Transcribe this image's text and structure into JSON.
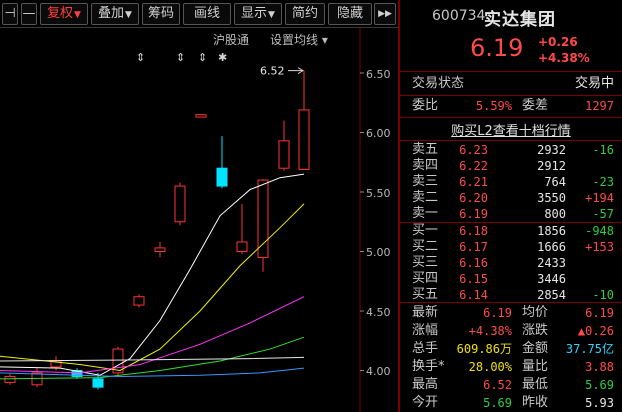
{
  "toolbar": {
    "first_glyph": "⊣",
    "minus": "—",
    "fuquan": "复权",
    "diejia": "叠加",
    "chouma": "筹码",
    "huaxian": "画线",
    "xianshi": "显示",
    "jianyue": "简约",
    "yincang": "隐藏",
    "dropdown_glyph": "▼",
    "expand_glyph": "▶▶"
  },
  "chart": {
    "link_hugutong": "沪股通",
    "link_settings": "设置均线",
    "settings_arrow": "▾",
    "marker_high_label": "6.52",
    "event_marks": [
      "⇕",
      "⇕",
      "⇕",
      "✱"
    ],
    "price_axis": [
      "6.50",
      "6.00",
      "5.50",
      "5.00",
      "4.50",
      "4.00"
    ],
    "colors": {
      "up": "#ff3232",
      "down": "#00e5ff",
      "ma_white": "#ffffff",
      "ma_yellow": "#f0f000",
      "ma_magenta": "#ff33ff",
      "ma_green": "#33dd33",
      "ma_blue": "#3399ff"
    }
  },
  "quote": {
    "code": "600734",
    "name": "实达集团",
    "price": "6.19",
    "change": "+0.26",
    "change_pct": "+4.38%",
    "trade_status_label": "交易状态",
    "trade_status_value": "交易中",
    "weibi_label": "委比",
    "weibi_value": "5.59%",
    "weicha_label": "委差",
    "weicha_value": "1297",
    "l2_link": "购买L2查看十档行情",
    "asks": [
      {
        "label": "卖五",
        "price": "6.23",
        "vol": "2932",
        "delta": "-16"
      },
      {
        "label": "卖四",
        "price": "6.22",
        "vol": "2912",
        "delta": ""
      },
      {
        "label": "卖三",
        "price": "6.21",
        "vol": "764",
        "delta": "-23"
      },
      {
        "label": "卖二",
        "price": "6.20",
        "vol": "3550",
        "delta": "+194"
      },
      {
        "label": "卖一",
        "price": "6.19",
        "vol": "800",
        "delta": "-57"
      }
    ],
    "bids": [
      {
        "label": "买一",
        "price": "6.18",
        "vol": "1856",
        "delta": "-948"
      },
      {
        "label": "买二",
        "price": "6.17",
        "vol": "1666",
        "delta": "+153"
      },
      {
        "label": "买三",
        "price": "6.16",
        "vol": "2433",
        "delta": ""
      },
      {
        "label": "买四",
        "price": "6.15",
        "vol": "3446",
        "delta": ""
      },
      {
        "label": "买五",
        "price": "6.14",
        "vol": "2854",
        "delta": "-10"
      }
    ],
    "stats": {
      "latest_label": "最新",
      "latest": "6.19",
      "avg_label": "均价",
      "avg": "6.19",
      "zf_label": "涨幅",
      "zf": "+4.38%",
      "zd_label": "涨跌",
      "zd": "▲0.26",
      "volume_label": "总手",
      "volume": "609.86万",
      "amount_label": "金额",
      "amount": "37.75亿",
      "turnover_label": "换手*",
      "turnover": "28.00%",
      "lb_label": "量比",
      "lb": "3.88",
      "high_label": "最高",
      "high": "6.52",
      "low_label": "最低",
      "low": "5.69",
      "open_label": "今开",
      "open": "5.69",
      "prev_label": "昨收",
      "prev": "5.93"
    }
  }
}
